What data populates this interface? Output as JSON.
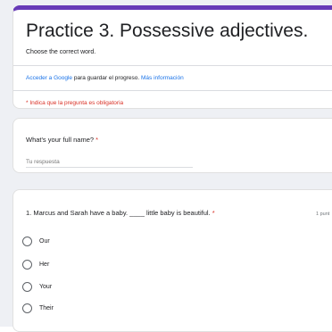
{
  "header": {
    "title": "Practice 3. Possessive adjectives.",
    "description": "Choose the correct word.",
    "signin_prefix": "Acceder a Google",
    "signin_mid": " para guardar el progreso. ",
    "signin_link": "Más información",
    "required_note": "* Indica que la pregunta es obligatoria"
  },
  "name_question": {
    "label": "What's your full name?",
    "required_mark": "*",
    "placeholder": "Tu respuesta"
  },
  "mc_question": {
    "label": "1. Marcus and Sarah have a baby. ____ little baby is beautiful.",
    "required_mark": "*",
    "points": "1 punt",
    "options": [
      "Our",
      "Her",
      "Your",
      "Their"
    ]
  },
  "colors": {
    "accent": "#673ab7",
    "link": "#1a73e8",
    "required": "#d93025"
  },
  "icons": {
    "radio": "radio-circle-icon"
  }
}
